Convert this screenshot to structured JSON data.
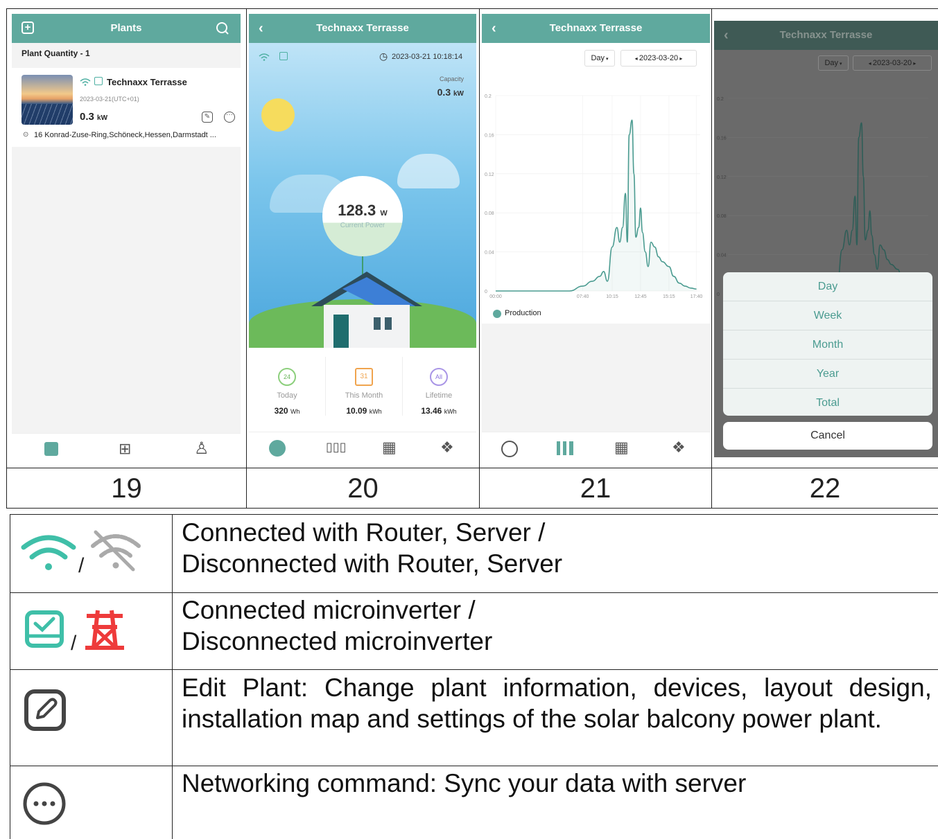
{
  "screens": [
    {
      "number": "19",
      "title": "Plants",
      "quantity_label": "Plant Quantity - 1",
      "plant_name": "Technaxx Terrasse",
      "plant_date": "2023-03-21(UTC+01)",
      "plant_power": "0.3",
      "plant_power_unit": "kW",
      "plant_address": "16 Konrad-Zuse-Ring,Schöneck,Hessen,Darmstadt ...",
      "tabs": [
        "list-icon",
        "grid-icon",
        "user-icon"
      ]
    },
    {
      "number": "20",
      "title": "Technaxx Terrasse",
      "timestamp": "2023-03-21 10:18:14",
      "capacity_label": "Capacity",
      "capacity_value": "0.3",
      "capacity_unit": "kW",
      "current_power": "128.3",
      "current_power_unit": "W",
      "current_power_label": "Current Power",
      "stats": [
        {
          "icon_text": "24",
          "label": "Today",
          "value": "320",
          "unit": "Wh"
        },
        {
          "icon_text": "31",
          "label": "This Month",
          "value": "10.09",
          "unit": "kWh"
        },
        {
          "icon_text": "All",
          "label": "Lifetime",
          "value": "13.46",
          "unit": "kWh"
        }
      ]
    },
    {
      "number": "21",
      "title": "Technaxx Terrasse",
      "period_selector": "Day",
      "date": "2023-03-20",
      "legend": "Production"
    },
    {
      "number": "22",
      "title": "Technaxx Terrasse",
      "period_selector": "Day",
      "date": "2023-03-20",
      "menu_options": [
        "Day",
        "Week",
        "Month",
        "Year",
        "Total"
      ],
      "cancel_label": "Cancel"
    }
  ],
  "chart_data": {
    "type": "line",
    "title": "",
    "xlabel": "",
    "ylabel": "",
    "x_ticks": [
      "00:00",
      "07:40",
      "10:15",
      "12:45",
      "15:15",
      "17:40"
    ],
    "y_ticks": [
      "0",
      "0.04",
      "0.08",
      "0.12",
      "0.16",
      "0.2"
    ],
    "ylim": [
      0,
      0.2
    ],
    "series": [
      {
        "name": "Production",
        "x": [
          "00:00",
          "06:30",
          "07:40",
          "08:30",
          "09:10",
          "09:30",
          "09:50",
          "10:15",
          "10:40",
          "10:55",
          "11:10",
          "11:25",
          "11:35",
          "11:45",
          "12:00",
          "12:10",
          "12:20",
          "12:35",
          "12:45",
          "12:55",
          "13:10",
          "13:25",
          "13:40",
          "14:00",
          "14:20",
          "14:40",
          "15:15",
          "15:40",
          "16:10",
          "16:40",
          "17:10",
          "17:40"
        ],
        "values": [
          0,
          0,
          0.005,
          0.01,
          0.015,
          0.02,
          0.01,
          0.045,
          0.065,
          0.05,
          0.065,
          0.1,
          0.05,
          0.16,
          0.175,
          0.12,
          0.055,
          0.065,
          0.085,
          0.06,
          0.04,
          0.025,
          0.05,
          0.045,
          0.035,
          0.03,
          0.025,
          0.015,
          0.008,
          0.005,
          0.003,
          0.002
        ]
      }
    ]
  },
  "legend_table": [
    {
      "icons": [
        "wifi-icon",
        "wifi-off-icon"
      ],
      "text": "Connected with Router, Server / Disconnected with Router, Server"
    },
    {
      "icons": [
        "microinverter-icon",
        "tower-icon"
      ],
      "text": "Connected microinverter / Disconnected microinverter"
    },
    {
      "icons": [
        "edit-icon"
      ],
      "text": "Edit Plant: Change plant information, devices, layout design, installation map and settings of the solar balcony power plant."
    },
    {
      "icons": [
        "more-icon"
      ],
      "text": "Networking command: Sync your data with server"
    }
  ],
  "colors": {
    "teal": "#5fa99e",
    "sky": "#4fb0e6",
    "cancel_overlay": "#5b5b5b"
  }
}
